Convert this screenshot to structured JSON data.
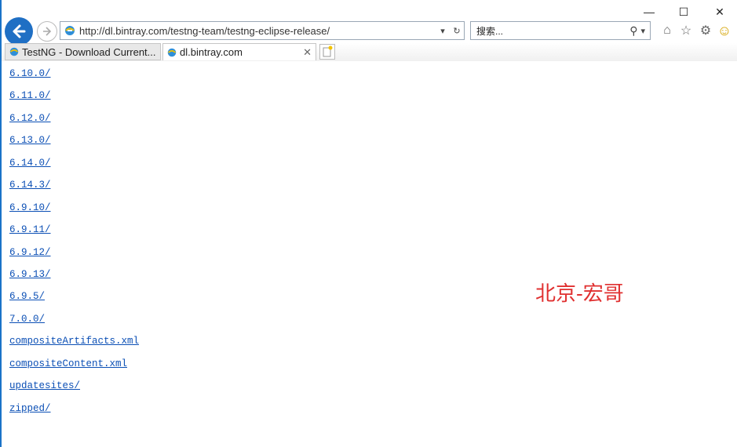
{
  "window": {
    "minimize": "—",
    "maximize": "☐",
    "close": "✕"
  },
  "toolbar": {
    "url": "http://dl.bintray.com/testng-team/testng-eclipse-release/",
    "dropdown_glyph": "▾",
    "refresh_glyph": "↻",
    "search_placeholder": "搜索...",
    "search_glyph": "⚲",
    "home_glyph": "⌂",
    "favorites_glyph": "☆",
    "settings_glyph": "⚙",
    "smiley_glyph": "☺"
  },
  "tabs": [
    {
      "title": "TestNG - Download Current...",
      "active": false
    },
    {
      "title": "dl.bintray.com",
      "active": true,
      "close": "✕"
    }
  ],
  "links": [
    "6.10.0/",
    "6.11.0/",
    "6.12.0/",
    "6.13.0/",
    "6.14.0/",
    "6.14.3/",
    "6.9.10/",
    "6.9.11/",
    "6.9.12/",
    "6.9.13/",
    "6.9.5/",
    "7.0.0/",
    "compositeArtifacts.xml",
    "compositeContent.xml",
    "updatesites/",
    "zipped/"
  ],
  "watermark": "北京-宏哥",
  "colors": {
    "accent": "#1f6fc4",
    "link": "#0b4fb5",
    "watermark": "#e03030"
  }
}
